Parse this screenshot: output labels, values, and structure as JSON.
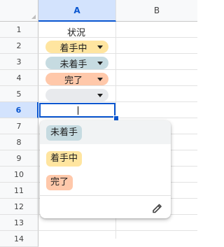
{
  "columns": [
    {
      "label": "A",
      "selected": true
    },
    {
      "label": "B",
      "selected": false
    }
  ],
  "rows": [
    "1",
    "2",
    "3",
    "4",
    "5",
    "6",
    "7",
    "8",
    "9",
    "10",
    "11",
    "12",
    "13",
    "14"
  ],
  "selected_row": "6",
  "header_cell": "状況",
  "chips": [
    {
      "row": "2",
      "label": "着手中",
      "color": "#ffe5a0"
    },
    {
      "row": "3",
      "label": "未着手",
      "color": "#c6dbe1"
    },
    {
      "row": "4",
      "label": "完了",
      "color": "#ffc8aa"
    },
    {
      "row": "5",
      "label": "",
      "color": "#e8eaed"
    }
  ],
  "dropdown": {
    "options": [
      {
        "label": "未着手",
        "color": "#c6dbe1"
      },
      {
        "label": "着手中",
        "color": "#ffe5a0"
      },
      {
        "label": "完了",
        "color": "#ffc8aa"
      }
    ],
    "edit_icon": "pencil-icon"
  },
  "colors": {
    "accent": "#0b57d0",
    "header_selected": "#d3e3fd"
  }
}
